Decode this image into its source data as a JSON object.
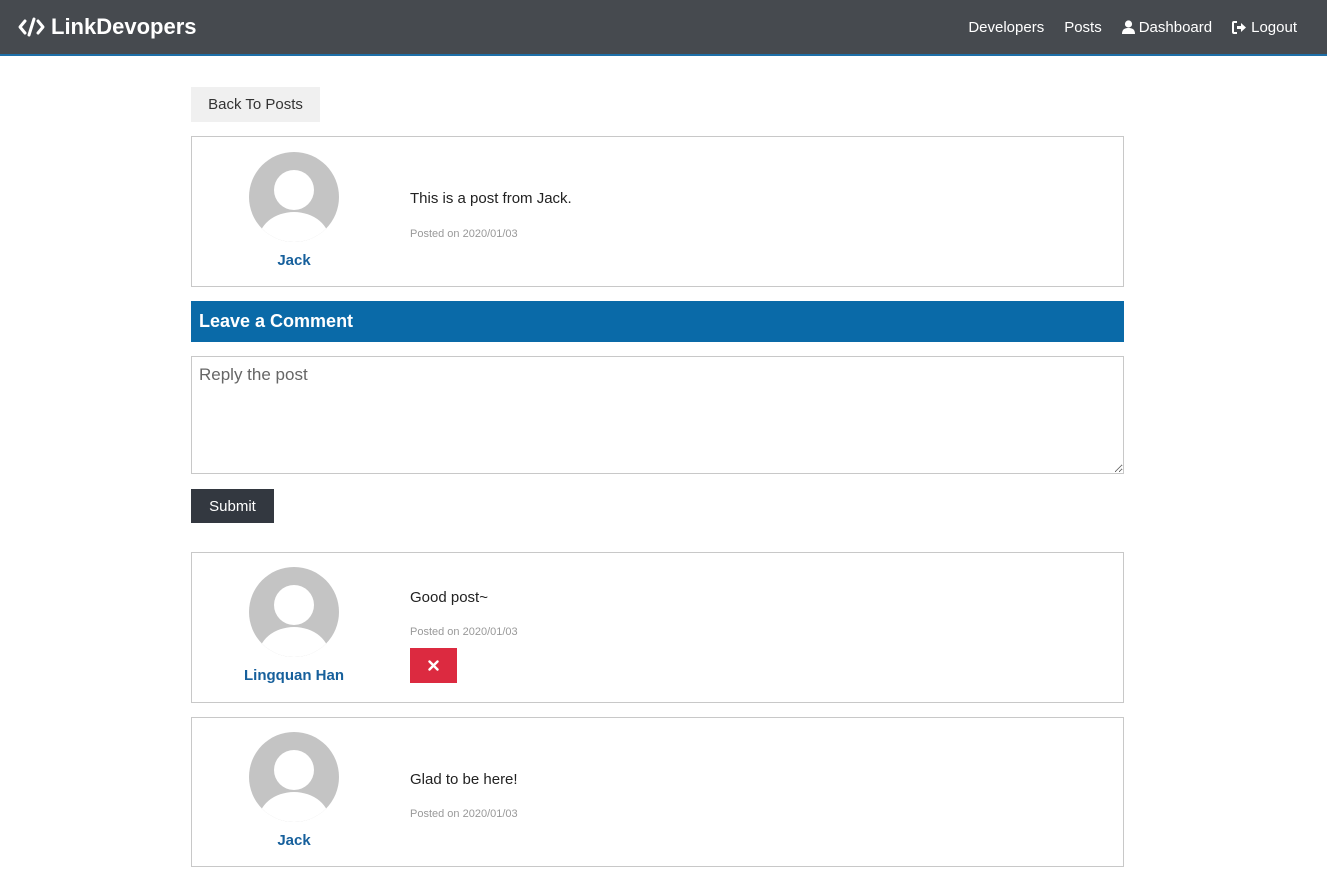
{
  "navbar": {
    "brand": "LinkDevopers",
    "links": {
      "developers": "Developers",
      "posts": "Posts",
      "dashboard": "Dashboard",
      "logout": "Logout"
    }
  },
  "back_button": "Back To Posts",
  "post": {
    "author": "Jack",
    "text": "This is a post from Jack.",
    "date": "Posted on 2020/01/03"
  },
  "comment_form": {
    "header": "Leave a Comment",
    "placeholder": "Reply the post",
    "submit_label": "Submit"
  },
  "comments": [
    {
      "author": "Lingquan Han",
      "text": "Good post~",
      "date": "Posted on 2020/01/03",
      "deletable": true
    },
    {
      "author": "Jack",
      "text": "Glad to be here!",
      "date": "Posted on 2020/01/03",
      "deletable": false
    }
  ],
  "colors": {
    "navbar": "#464a4f",
    "accent": "#0a6aa8",
    "author_link": "#17609c",
    "delete": "#dc2a40",
    "submit": "#333840"
  }
}
